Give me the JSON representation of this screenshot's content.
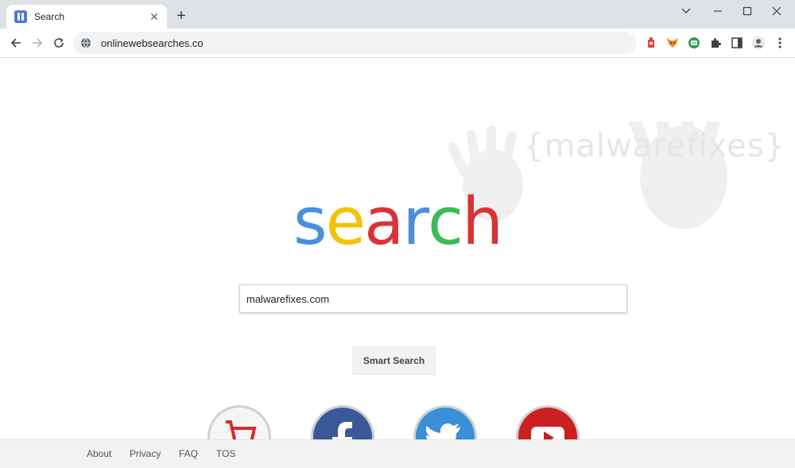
{
  "browser": {
    "tab": {
      "title": "Search",
      "close_icon": "close-icon",
      "favicon": "site-favicon"
    },
    "new_tab_icon": "plus-icon",
    "window_controls": [
      "chevron-down-icon",
      "minimize-icon",
      "maximize-icon",
      "close-icon"
    ],
    "toolbar": {
      "url": "onlinewebsearches.co",
      "security_icon": "globe-icon",
      "extensions": [
        "extension-red-icon",
        "fox-icon",
        "extension-green-icon",
        "puzzle-icon",
        "sidepanel-icon",
        "profile-icon",
        "kebab-menu-icon"
      ]
    }
  },
  "page": {
    "watermark_text": "{malwarefixes}",
    "logo": {
      "letters": [
        "s",
        "e",
        "a",
        "r",
        "c",
        "h"
      ],
      "colors": [
        "#4a8fdb",
        "#f4c20d",
        "#db3236",
        "#4a8fdb",
        "#3cba54",
        "#db3236"
      ]
    },
    "search": {
      "value": "malwarefixes.com",
      "placeholder": ""
    },
    "smart_search_label": "Smart Search",
    "shortcuts": [
      "aliexpress-icon",
      "facebook-icon",
      "twitter-icon",
      "youtube-icon"
    ],
    "footer": {
      "links": [
        "About",
        "Privacy",
        "FAQ",
        "TOS"
      ]
    }
  },
  "colors": {
    "accent": "#4a8fdb",
    "footer_bg": "#f2f2f2"
  }
}
